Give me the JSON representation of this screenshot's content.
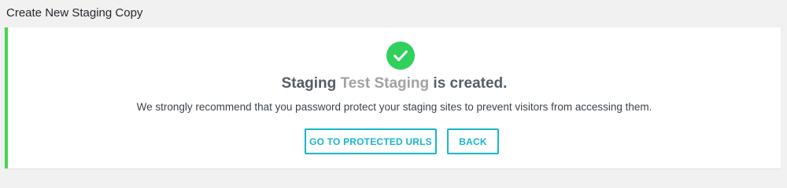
{
  "page": {
    "title": "Create New Staging Copy"
  },
  "panel": {
    "accent_color": "#46d653",
    "icon": "check-icon",
    "headline_prefix": "Staging",
    "staging_name": "Test Staging",
    "headline_suffix": "is created.",
    "message": "We strongly recommend that you password protect your staging sites to prevent visitors from accessing them."
  },
  "buttons": {
    "protected_urls_label": "GO TO PROTECTED URLS",
    "back_label": "BACK",
    "color": "#1ab5c9"
  }
}
